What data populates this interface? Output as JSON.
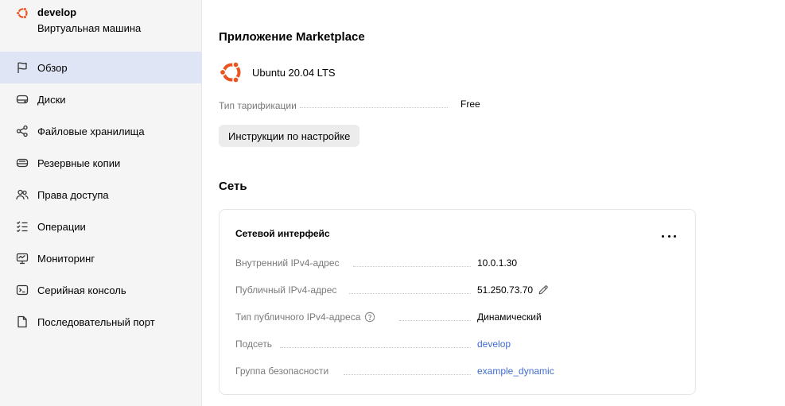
{
  "vm": {
    "name": "develop",
    "type": "Виртуальная машина"
  },
  "nav": [
    {
      "label": "Обзор",
      "icon": "flag-icon",
      "active": true
    },
    {
      "label": "Диски",
      "icon": "disk-icon"
    },
    {
      "label": "Файловые хранилища",
      "icon": "share-nodes-icon"
    },
    {
      "label": "Резервные копии",
      "icon": "backup-disk-icon"
    },
    {
      "label": "Права доступа",
      "icon": "users-icon"
    },
    {
      "label": "Операции",
      "icon": "checklist-icon"
    },
    {
      "label": "Мониторинг",
      "icon": "monitor-icon"
    },
    {
      "label": "Серийная консоль",
      "icon": "terminal-icon"
    },
    {
      "label": "Последовательный порт",
      "icon": "document-icon"
    }
  ],
  "marketplace": {
    "heading": "Приложение Marketplace",
    "product": "Ubuntu 20.04 LTS",
    "tariff_label": "Тип тарификации",
    "tariff_value": "Free",
    "instructions_button": "Инструкции по настройке"
  },
  "network": {
    "heading": "Сеть",
    "card_title": "Сетевой интерфейс",
    "internal_ipv4_label": "Внутренний IPv4-адрес",
    "internal_ipv4_value": "10.0.1.30",
    "public_ipv4_label": "Публичный IPv4-адрес",
    "public_ipv4_value": "51.250.73.70",
    "public_ipv4_type_label": "Тип публичного IPv4-адреса",
    "public_ipv4_type_value": "Динамический",
    "subnet_label": "Подсеть",
    "subnet_value": "develop",
    "security_group_label": "Группа безопасности",
    "security_group_value": "example_dynamic"
  },
  "colors": {
    "ubuntu_orange": "#e95420",
    "active_nav_bg": "#e0e5f5",
    "link": "#3f6cd0"
  }
}
